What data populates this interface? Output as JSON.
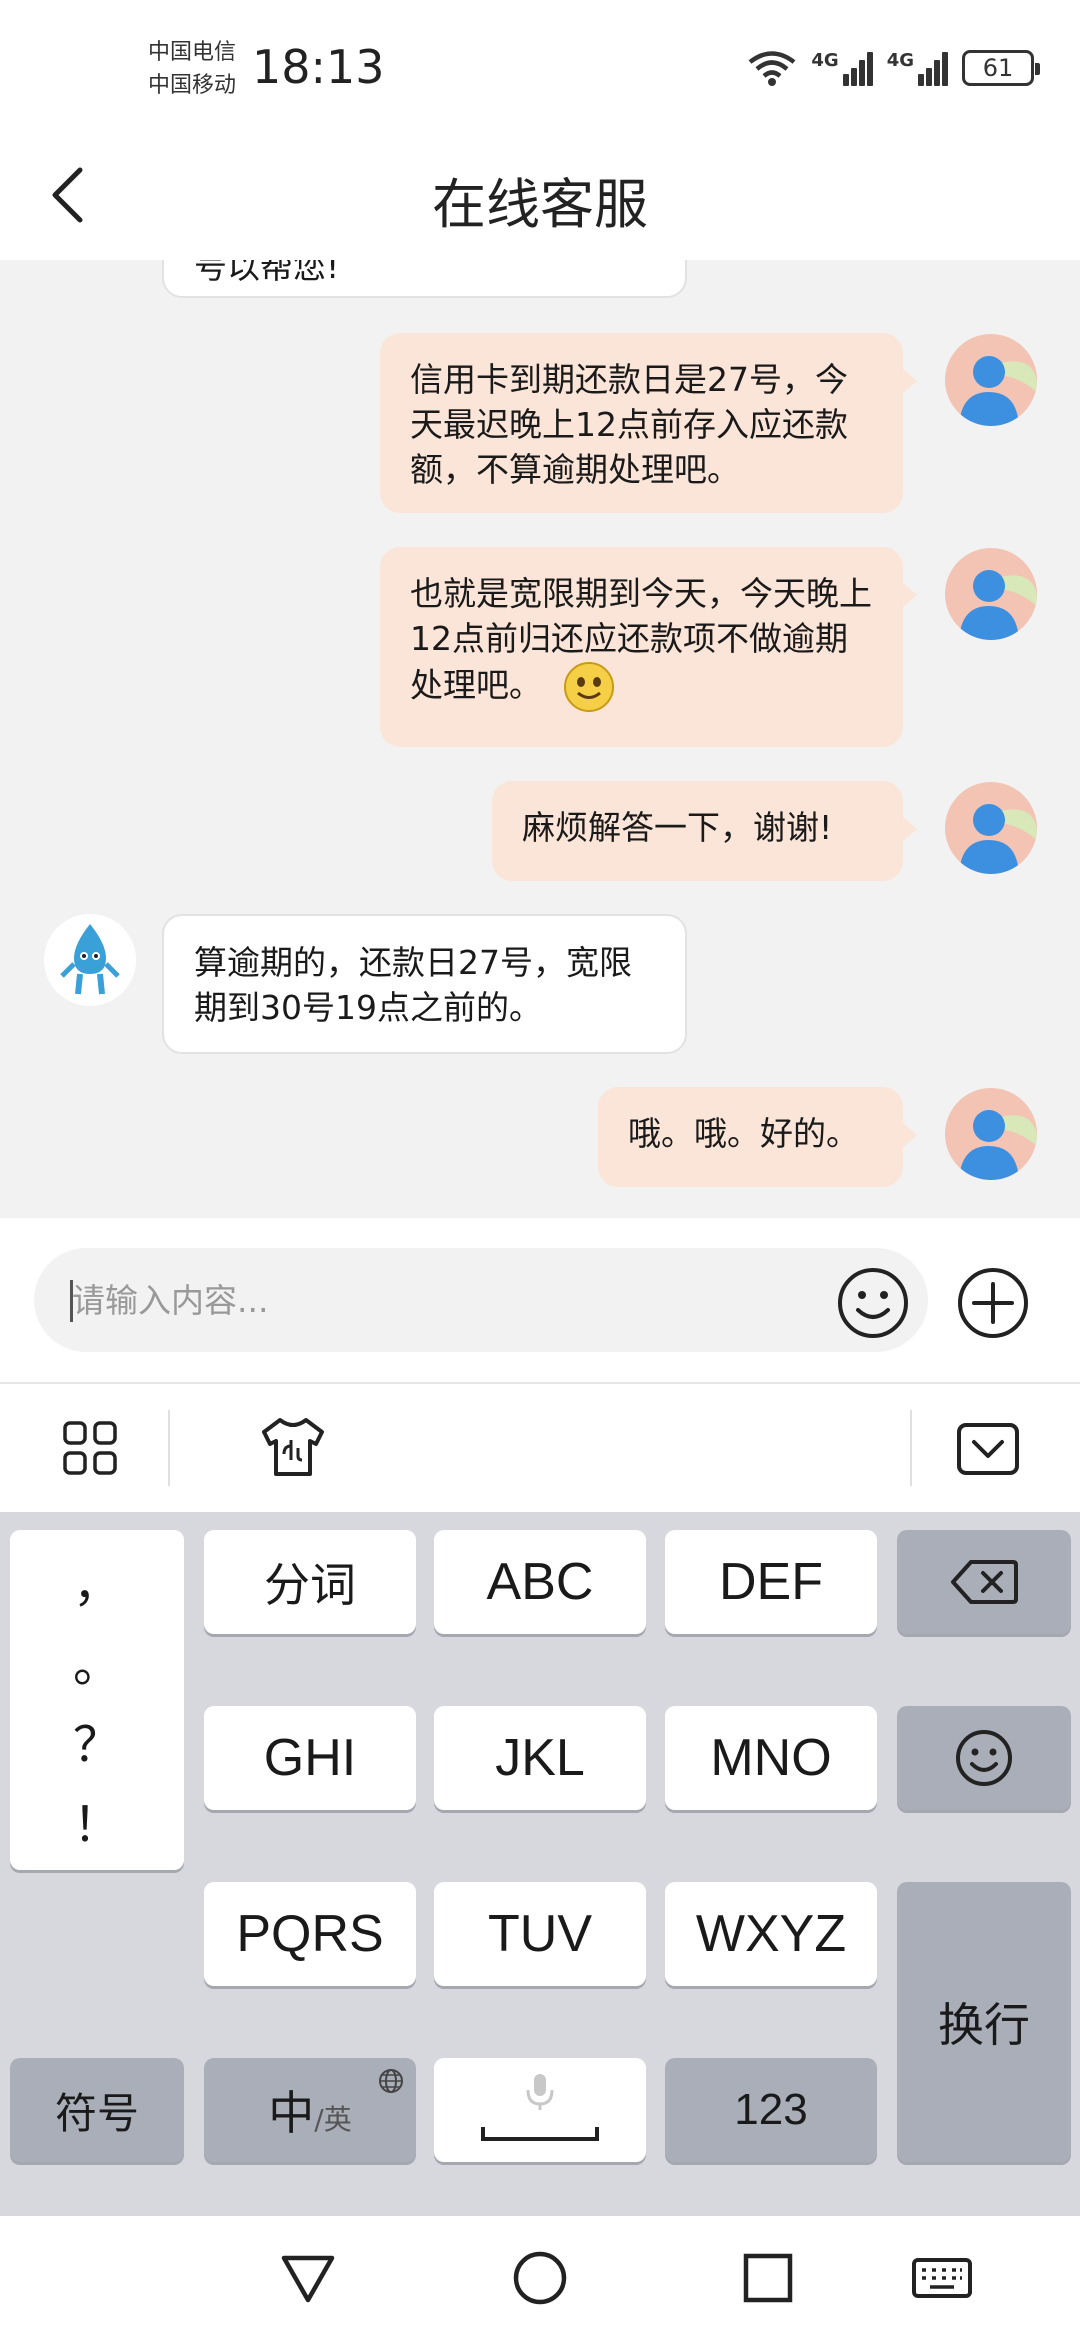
{
  "status": {
    "carrier1": "中国电信",
    "carrier2": "中国移动",
    "time": "18:13",
    "net1": "4G",
    "net2": "4G",
    "battery": "61"
  },
  "header": {
    "title": "在线客服"
  },
  "chat": {
    "partial_text": "号以帮您!",
    "messages": [
      {
        "from": "me",
        "text": "信用卡到期还款日是27号，今天最迟晚上12点前存入应还款额，不算逾期处理吧。"
      },
      {
        "from": "me",
        "text": "也就是宽限期到今天，今天晚上12点前归还应还款项不做逾期处理吧。"
      },
      {
        "from": "me",
        "text": "麻烦解答一下，谢谢!"
      },
      {
        "from": "bot",
        "text": "算逾期的，还款日27号，宽限期到30号19点之前的。"
      },
      {
        "from": "me",
        "text": "哦。哦。好的。"
      }
    ]
  },
  "input": {
    "placeholder": "请输入内容..."
  },
  "keyboard": {
    "punct": [
      "，",
      "。",
      "？",
      "！"
    ],
    "row1": [
      "分词",
      "ABC",
      "DEF"
    ],
    "row2": [
      "GHI",
      "JKL",
      "MNO"
    ],
    "row3": [
      "PQRS",
      "TUV",
      "WXYZ"
    ],
    "symbols": "符号",
    "lang_main": "中",
    "lang_sub": "/英",
    "num": "123",
    "enter": "换行"
  }
}
